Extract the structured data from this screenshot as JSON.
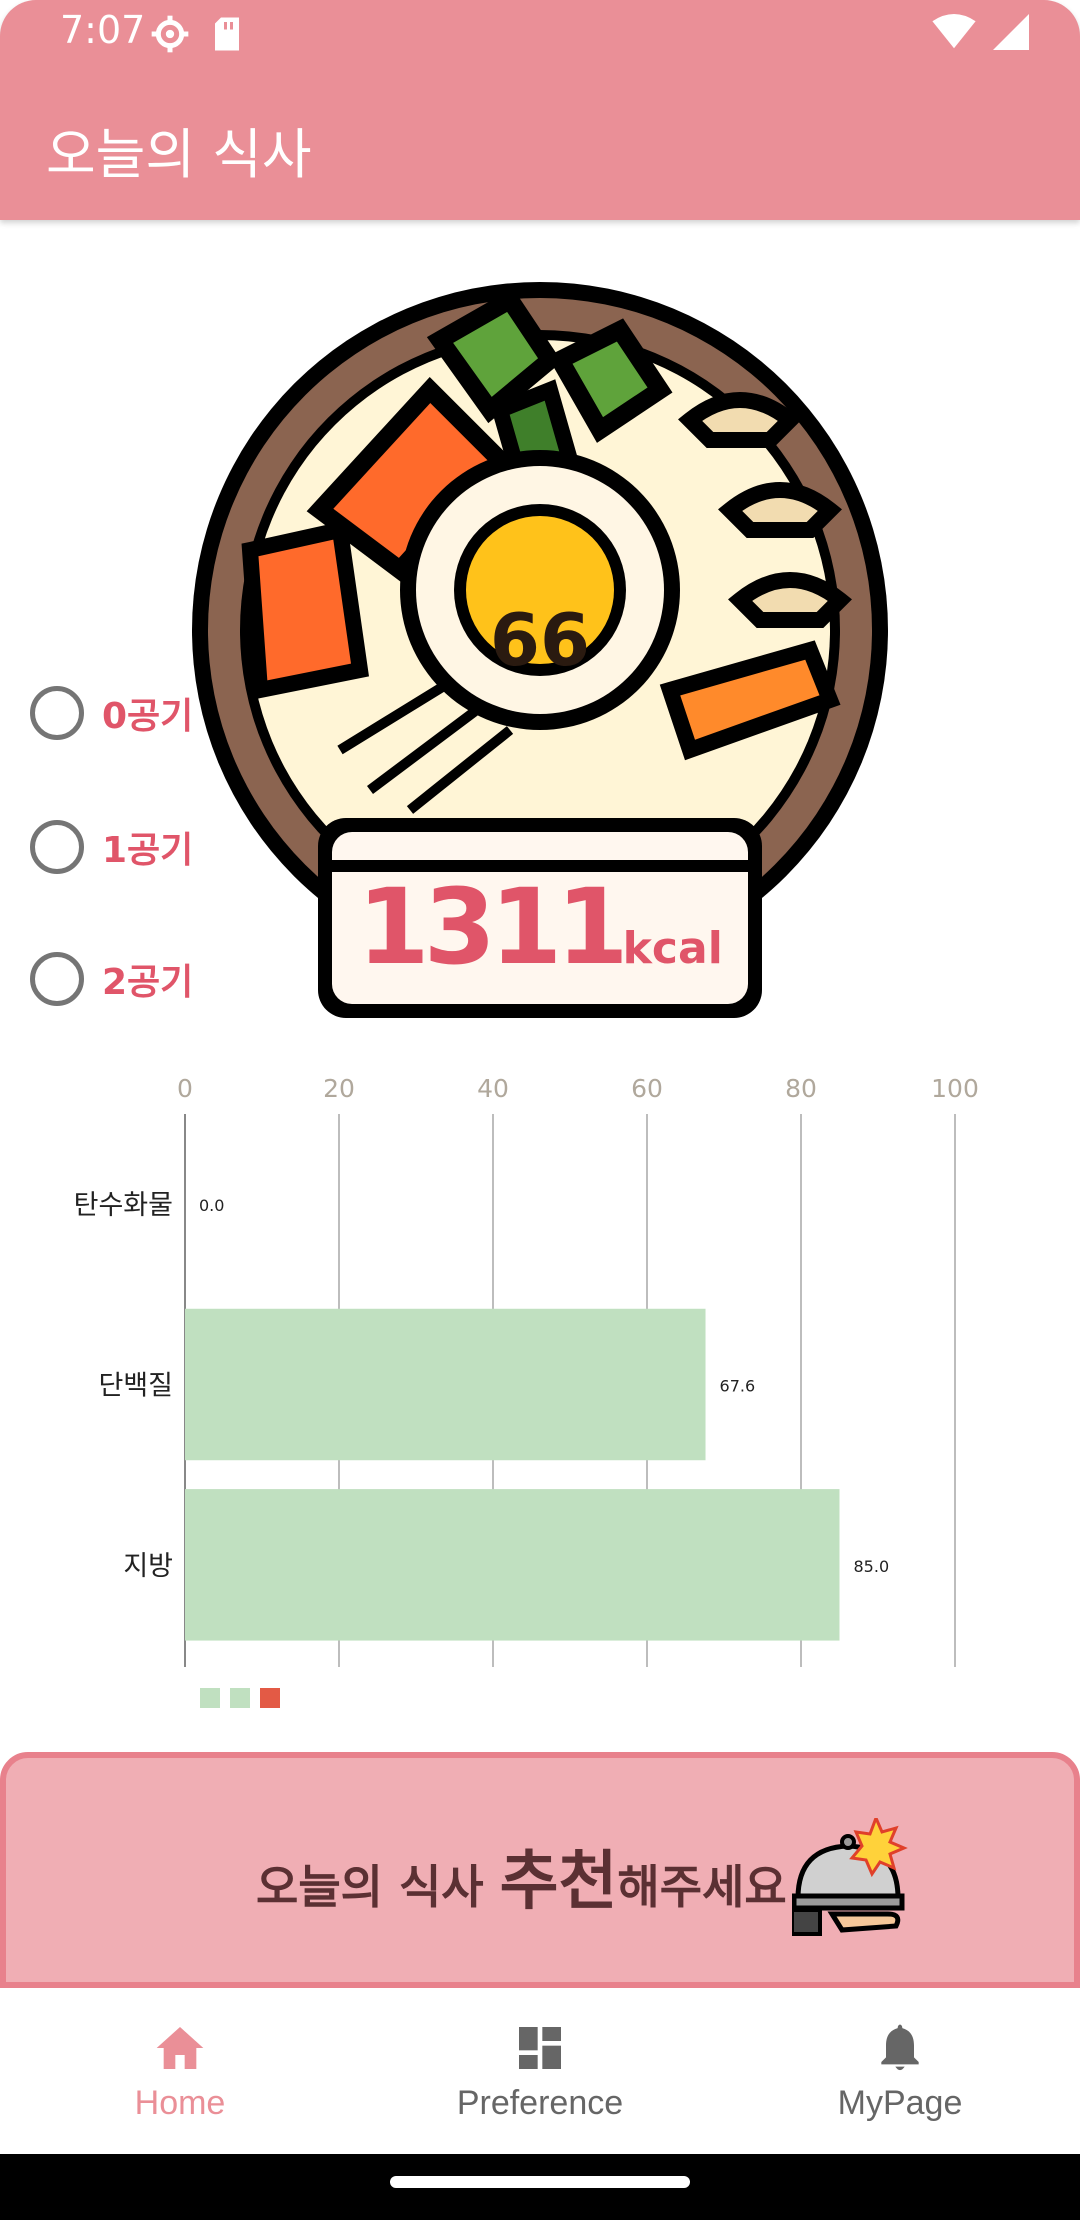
{
  "status_bar": {
    "time": "7:07",
    "icons": [
      "settings-icon",
      "sd-card-icon",
      "wifi-icon",
      "signal-icon"
    ]
  },
  "app_bar": {
    "title": "오늘의 식사"
  },
  "meal_summary": {
    "badge_value": "66",
    "calories": "1311",
    "calories_unit": "kcal"
  },
  "rice_options": [
    {
      "label": "0공기",
      "selected": false
    },
    {
      "label": "1공기",
      "selected": false
    },
    {
      "label": "2공기",
      "selected": false
    }
  ],
  "chart_data": {
    "type": "bar",
    "orientation": "horizontal",
    "categories": [
      "탄수화물",
      "단백질",
      "지방"
    ],
    "values": [
      0.0,
      67.6,
      85.0
    ],
    "value_labels": [
      "0.0",
      "67.6",
      "85.0"
    ],
    "xlim": [
      0,
      100
    ],
    "ticks": [
      "0",
      "20",
      "40",
      "60",
      "80",
      "100"
    ],
    "grid": true,
    "bar_color": "#c0e0c0",
    "legend_colors": [
      "#c0e0c0",
      "#c0e0c0",
      "#e35a45"
    ]
  },
  "banner": {
    "text_prefix": "오늘의 식사 ",
    "text_emphasis": "추천",
    "text_suffix": "해주세요"
  },
  "bottom_nav": {
    "items": [
      {
        "label": "Home",
        "icon": "home-icon",
        "active": true
      },
      {
        "label": "Preference",
        "icon": "dashboard-icon",
        "active": false
      },
      {
        "label": "MyPage",
        "icon": "bell-icon",
        "active": false
      }
    ],
    "active_color": "#ea8f97"
  },
  "colors": {
    "primary": "#ea8f97",
    "accent_text": "#e05569",
    "banner_bg": "#f0aeb4"
  }
}
